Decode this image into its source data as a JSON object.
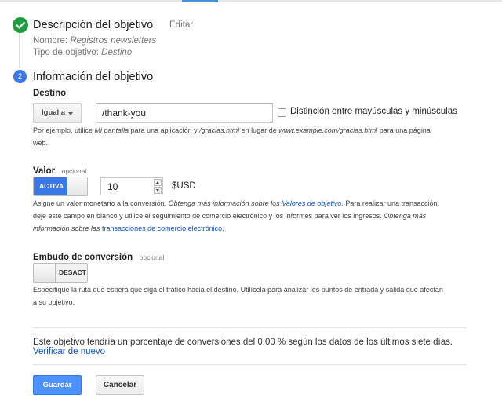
{
  "step1": {
    "title": "Descripción del objetivo",
    "edit_link": "Editar",
    "name_label": "Nombre:",
    "name_value": "Registros newsletters",
    "type_label": "Tipo de objetivo:",
    "type_value": "Destino"
  },
  "step2": {
    "number": "2",
    "title": "Información del objetivo"
  },
  "destination": {
    "label": "Destino",
    "match_type": "Igual a",
    "value": "/thank-you",
    "case_label": "Distinción entre mayúsculas y minúsculas",
    "help_1": "Por ejemplo, utilice ",
    "help_2": "Mi pantalla",
    "help_3": " para una aplicación y ",
    "help_4": "/gracias.html",
    "help_5": " en lugar de ",
    "help_6": "www.example.com/gracias.html",
    "help_7": " para una página",
    "help_8": "web."
  },
  "value": {
    "label": "Valor",
    "optional": "opcional",
    "toggle_label": "ACTIVA",
    "amount": "10",
    "currency": "$USD",
    "help_1": "Asigne un valor monetario a la conversión. ",
    "help_2": "Obtenga más información sobre los ",
    "help_3": "Valores de objetivo",
    "help_4": ".",
    "help_5": " Para realizar una transacción,",
    "help_6": "deje este campo en blanco y utilice el seguimiento de comercio electrónico y los informes para ver los ingresos. ",
    "help_7": "Obtenga más",
    "help_8": "información sobre las ",
    "help_9": "transacciones de comercio electrónico",
    "help_10": "."
  },
  "funnel": {
    "label": "Embudo de conversión",
    "optional": "opcional",
    "toggle_label": "DESACT",
    "help_1": "Especifique la ruta que espera que siga el tráfico hacia el destino. Utilícela para analizar los puntos de entrada y salida que afectan",
    "help_2": "a su objetivo."
  },
  "verify": {
    "text": "Este objetivo tendría un porcentaje de conversiones del 0,00 % según los datos de los últimos siete días.",
    "link": "Verificar de nuevo"
  },
  "actions": {
    "save": "Guardar",
    "cancel": "Cancelar"
  },
  "colors": {
    "accent": "#3b78e7",
    "success": "#1e9e3e",
    "link": "#1155cc"
  },
  "icons": {
    "step1": "check-icon",
    "dropdown": "caret-down-icon"
  }
}
